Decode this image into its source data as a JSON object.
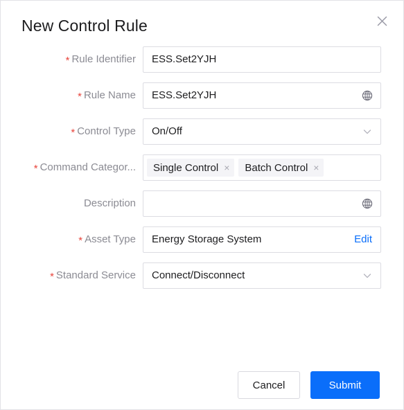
{
  "dialog": {
    "title": "New Control Rule",
    "close_icon": "close-icon"
  },
  "colors": {
    "primary": "#0a6efa",
    "required_asterisk": "#e8453c",
    "label_text": "#8b8b93",
    "value_text": "#1d1d1f",
    "field_border": "#dcdce2",
    "tag_background": "#f4f4f7"
  },
  "fields": [
    {
      "label": "Rule Identifier",
      "required": true,
      "value": "ESS.Set2YJH",
      "placeholder": "",
      "control": "text",
      "suffix": "none"
    },
    {
      "label": "Rule Name",
      "required": true,
      "value": "ESS.Set2YJH",
      "placeholder": "",
      "control": "text",
      "suffix": "globe-icon"
    },
    {
      "label": "Control Type",
      "required": true,
      "value": "On/Off",
      "placeholder": "",
      "control": "select",
      "suffix": "chevron-down-icon"
    },
    {
      "label": "Command Categor...",
      "required": true,
      "value": "",
      "placeholder": "",
      "control": "tags",
      "suffix": "none",
      "tags": [
        {
          "label": "Single Control",
          "remove_icon": "close-icon"
        },
        {
          "label": "Batch Control",
          "remove_icon": "close-icon"
        }
      ]
    },
    {
      "label": "Description",
      "required": false,
      "value": "",
      "placeholder": "",
      "control": "text",
      "suffix": "globe-icon"
    },
    {
      "label": "Asset Type",
      "required": true,
      "value": "Energy Storage System",
      "placeholder": "",
      "control": "text",
      "suffix": "edit-link",
      "action_label": "Edit"
    },
    {
      "label": "Standard Service",
      "required": true,
      "value": "Connect/Disconnect",
      "placeholder": "",
      "control": "select",
      "suffix": "chevron-down-icon"
    }
  ],
  "footer": {
    "cancel_label": "Cancel",
    "submit_label": "Submit"
  }
}
